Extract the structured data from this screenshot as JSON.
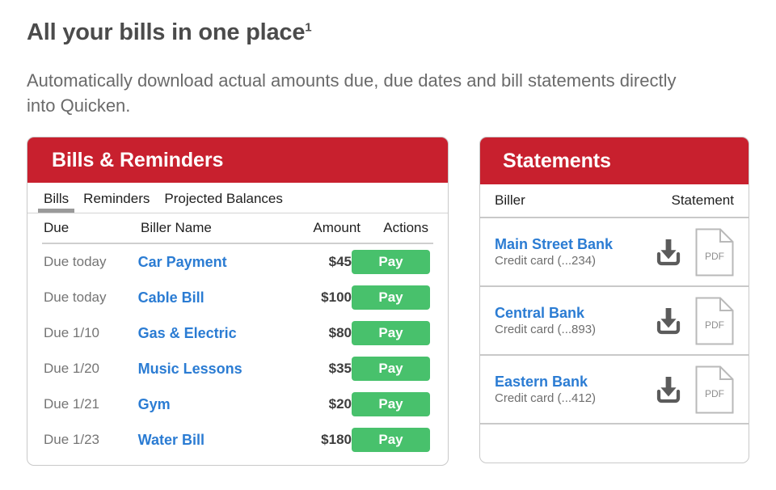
{
  "headline": {
    "text": "All your bills in one place",
    "footnote": "1"
  },
  "subhead": "Automatically download actual amounts due, due dates and bill statements directly into Quicken.",
  "colors": {
    "header_red": "#c8202e",
    "link_blue": "#2b7cd3",
    "pay_green": "#48c16c",
    "text_gray": "#4b4b4b",
    "muted_gray": "#757575",
    "border_gray": "#c9c9c9"
  },
  "bills_panel": {
    "title": "Bills & Reminders",
    "tabs": [
      {
        "label": "Bills",
        "active": true
      },
      {
        "label": "Reminders",
        "active": false
      },
      {
        "label": "Projected Balances",
        "active": false
      }
    ],
    "columns": {
      "due": "Due",
      "biller": "Biller Name",
      "amount": "Amount",
      "actions": "Actions"
    },
    "pay_label": "Pay",
    "rows": [
      {
        "due": "Due today",
        "biller": "Car Payment",
        "amount": "$45",
        "action": "Pay"
      },
      {
        "due": "Due today",
        "biller": "Cable Bill",
        "amount": "$100",
        "action": "Pay"
      },
      {
        "due": "Due 1/10",
        "biller": "Gas & Electric",
        "amount": "$80",
        "action": "Pay"
      },
      {
        "due": "Due 1/20",
        "biller": "Music Lessons",
        "amount": "$35",
        "action": "Pay"
      },
      {
        "due": "Due 1/21",
        "biller": "Gym",
        "amount": "$20",
        "action": "Pay"
      },
      {
        "due": "Due 1/23",
        "biller": "Water Bill",
        "amount": "$180",
        "action": "Pay"
      }
    ]
  },
  "statements_panel": {
    "title": "Statements",
    "columns": {
      "biller": "Biller",
      "statement": "Statement"
    },
    "pdf_label": "PDF",
    "rows": [
      {
        "bank": "Main Street Bank",
        "account": "Credit card (...234)"
      },
      {
        "bank": "Central Bank",
        "account": "Credit card (...893)"
      },
      {
        "bank": "Eastern Bank",
        "account": "Credit card (...412)"
      }
    ]
  }
}
